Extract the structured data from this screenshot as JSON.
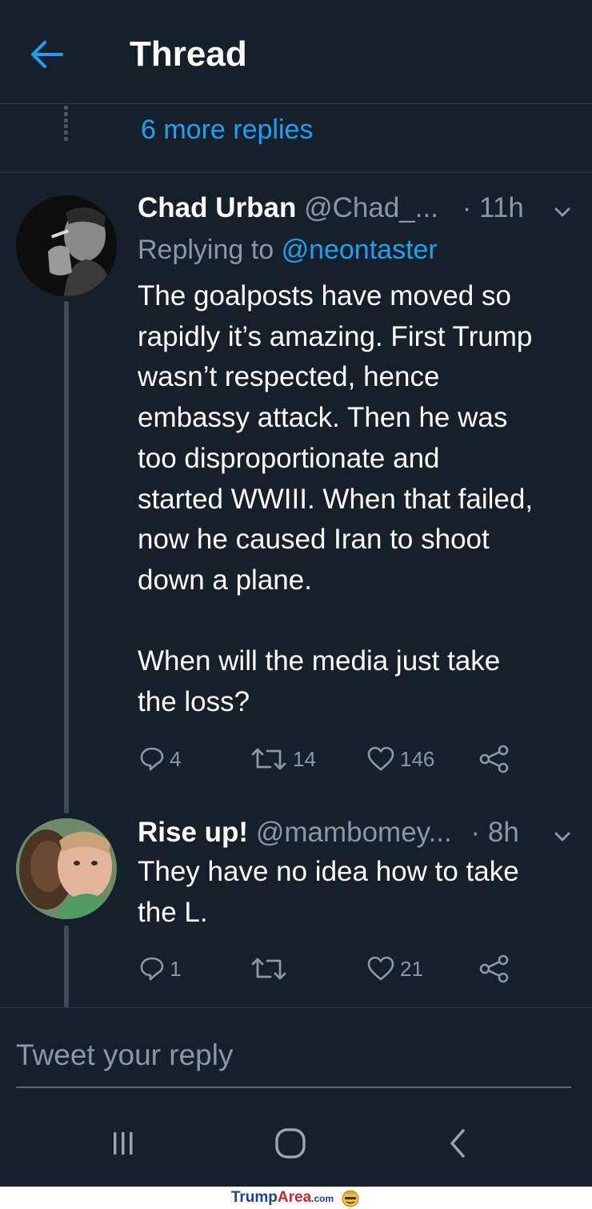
{
  "header": {
    "title": "Thread"
  },
  "thread": {
    "more_replies": "6 more replies"
  },
  "tweets": [
    {
      "name": "Chad Urban",
      "handle": "@Chad_...",
      "time": "· 11h",
      "replying_prefix": "Replying to",
      "replying_to": "@neontaster",
      "body": "The goalposts have moved so\nrapidly it’s amazing. First Trump\nwasn’t respected, hence\nembassy attack. Then he was\ntoo disproportionate and\nstarted WWIII. When that failed,\nnow he caused Iran to shoot\ndown a plane.\n\nWhen will the media just take\nthe loss?",
      "replies": "4",
      "retweets": "14",
      "likes": "146"
    },
    {
      "name": "Rise up!",
      "handle": "@mambomey...",
      "time": "· 8h",
      "body": "They have no idea how to take\nthe L.",
      "replies": "1",
      "retweets": "",
      "likes": "21"
    }
  ],
  "reply_bar": {
    "placeholder": "Tweet your reply"
  },
  "watermark": {
    "brand_main": "Trump",
    "brand_accent": "Area",
    "brand_domain": ".com"
  },
  "colors": {
    "background": "#15202b",
    "accent": "#1da1f2",
    "secondary_text": "#8899a6",
    "divider": "#2f3b47"
  }
}
